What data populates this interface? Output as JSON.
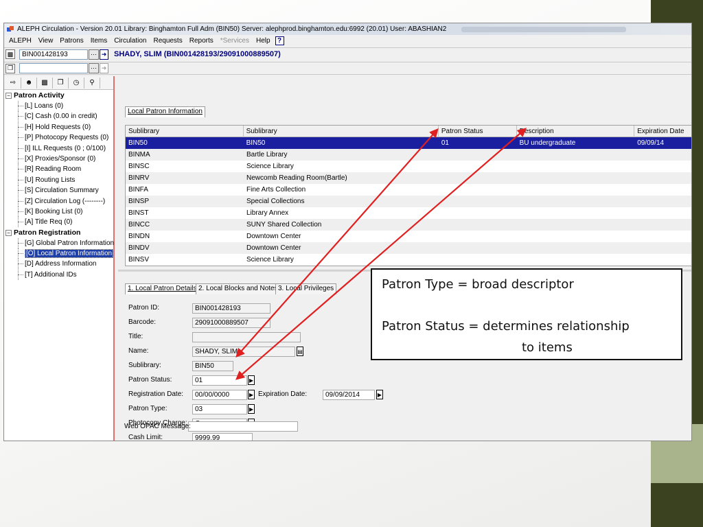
{
  "window": {
    "title": "ALEPH Circulation - Version 20.01  Library:  Binghamton Full Adm (BIN50)  Server:  alephprod.binghamton.edu:6992 (20.01)  User:  ABASHIAN2"
  },
  "menu": [
    "ALEPH",
    "View",
    "Patrons",
    "Items",
    "Circulation",
    "Requests",
    "Reports"
  ],
  "menu_disabled": "*Services",
  "menu_help": "Help",
  "toolbar": {
    "patron_id_value": "BIN001428193",
    "patron_name": "SHADY, SLIM (BIN001428193/29091000889507)",
    "second_field_value": ""
  },
  "tree": {
    "groups": [
      {
        "label": "Patron Activity",
        "items": [
          "[L] Loans (0)",
          "[C] Cash (0.00 in credit)",
          "[H] Hold Requests (0)",
          "[P] Photocopy Requests (0)",
          "[I] ILL Requests (0 ; 0/100)",
          "[X] Proxies/Sponsor (0)",
          "[R] Reading Room",
          "[U] Routing Lists",
          "[S] Circulation Summary",
          "[Z] Circulation Log (--------)",
          "[K] Booking List (0)",
          "[A] Title Req (0)"
        ]
      },
      {
        "label": "Patron Registration",
        "items": [
          "[G] Global Patron Information",
          "[O] Local Patron Information",
          "[D] Address Information",
          "[T] Additional IDs"
        ]
      }
    ]
  },
  "top_tab": "Local Patron Information",
  "grid": {
    "headers": [
      "Sublibrary",
      "Sublibrary",
      "Patron Status",
      "Description",
      "Expiration Date"
    ],
    "rows": [
      [
        "BIN50",
        "BIN50",
        "01",
        "BU undergraduate",
        "09/09/14"
      ],
      [
        "BINMA",
        "Bartle Library",
        "",
        "",
        ""
      ],
      [
        "BINSC",
        "Science Library",
        "",
        "",
        ""
      ],
      [
        "BINRV",
        "Newcomb Reading Room(Bartle)",
        "",
        "",
        ""
      ],
      [
        "BINFA",
        "Fine Arts Collection",
        "",
        "",
        ""
      ],
      [
        "BINSP",
        "Special Collections",
        "",
        "",
        ""
      ],
      [
        "BINST",
        "Library Annex",
        "",
        "",
        ""
      ],
      [
        "BINCC",
        "SUNY Shared Collection",
        "",
        "",
        ""
      ],
      [
        "BINDN",
        "Downtown Center",
        "",
        "",
        ""
      ],
      [
        "BINDV",
        "Downtown Center",
        "",
        "",
        ""
      ],
      [
        "BINSV",
        "Science Library",
        "",
        "",
        ""
      ]
    ]
  },
  "detail_tabs": [
    "1. Local Patron Details",
    "2. Local Blocks and Notes",
    "3. Local Privileges"
  ],
  "details": {
    "patron_id_label": "Patron ID:",
    "patron_id": "BIN001428193",
    "barcode_label": "Barcode:",
    "barcode": "29091000889507",
    "title_label": "Title:",
    "title": "",
    "name_label": "Name:",
    "name": "SHADY, SLIM",
    "sublibrary_label": "Sublibrary:",
    "sublibrary": "BIN50",
    "patron_status_label": "Patron Status:",
    "patron_status": "01",
    "registration_date_label": "Registration Date:",
    "registration_date": "00/00/0000",
    "expiration_date_label": "Expiration Date:",
    "expiration_date": "09/09/2014",
    "patron_type_label": "Patron Type:",
    "patron_type": "03",
    "photocopy_charge_label": "Photocopy Charge:",
    "photocopy_charge": "C",
    "cash_limit_label": "Cash Limit:",
    "cash_limit": "9999.99",
    "web_opac_label": "Web OPAC Message:",
    "web_opac": ""
  },
  "callout": {
    "line1": "Patron Type =  broad descriptor",
    "line2": "Patron Status = determines relationship",
    "line3": "to items"
  },
  "colors": {
    "selection": "#1a1fa0",
    "arrow": "#e02020",
    "accent_dark": "#3b4220",
    "accent_light": "#aab48c"
  }
}
